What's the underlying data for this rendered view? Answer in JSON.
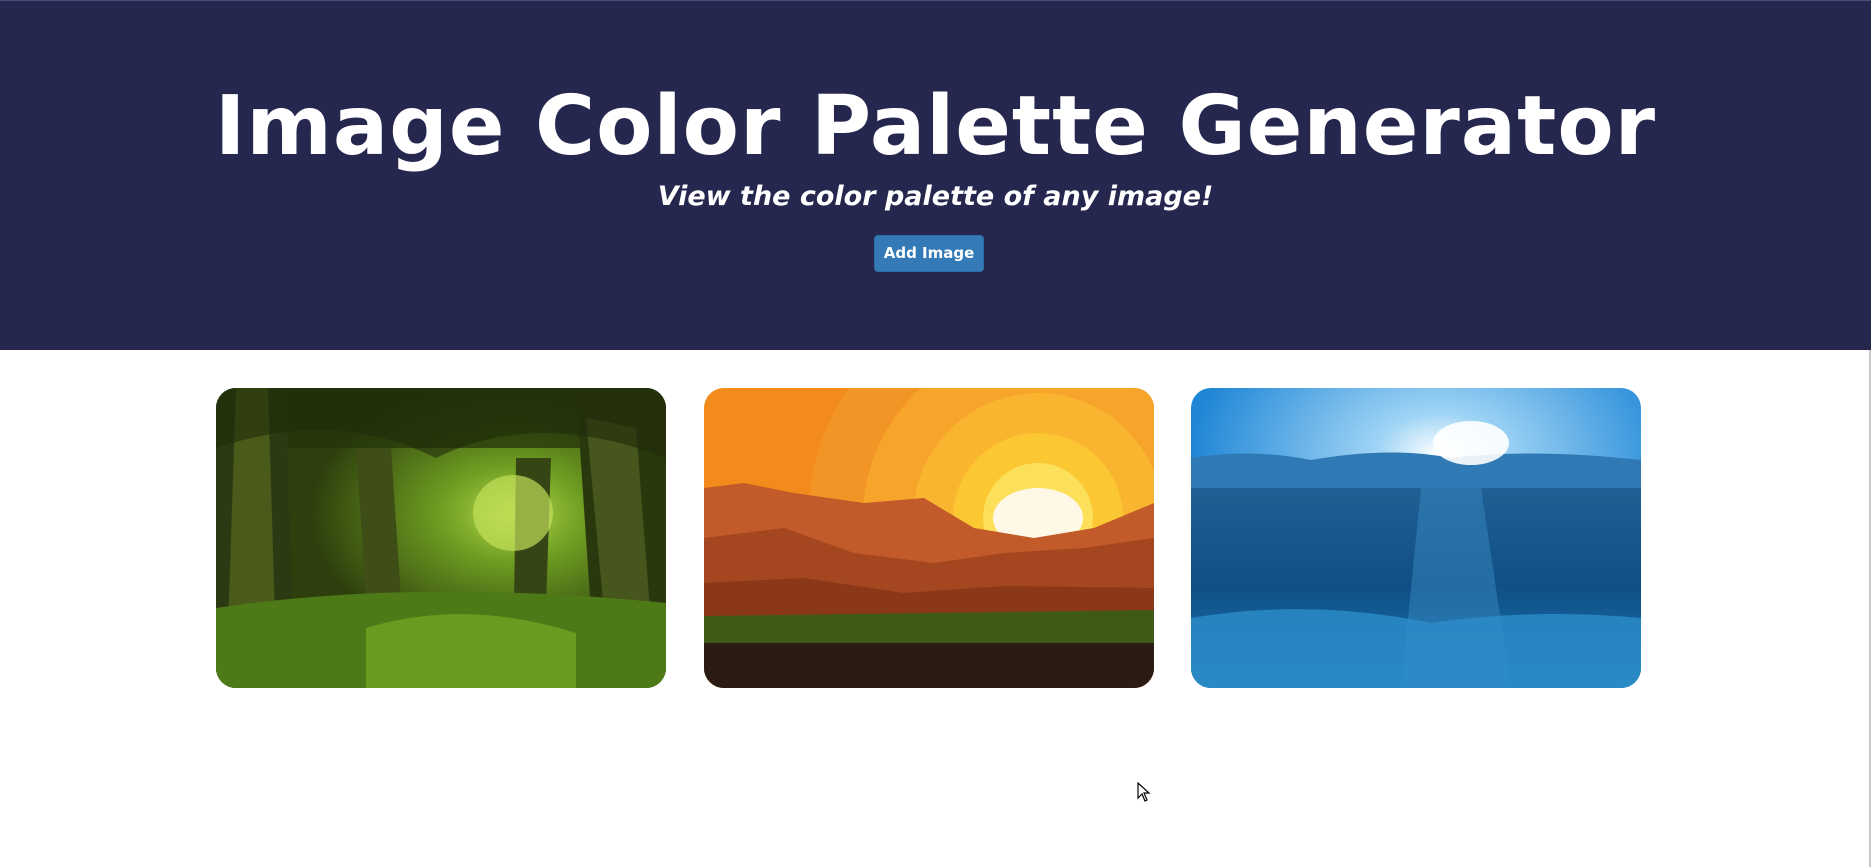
{
  "header": {
    "title": "Image Color Palette Generator",
    "subtitle": "View the color palette of any image!",
    "add_button_label": "Add Image"
  },
  "gallery": {
    "images": [
      {
        "subject": "forest-path"
      },
      {
        "subject": "desert-sunset"
      },
      {
        "subject": "underwater-ocean"
      }
    ]
  },
  "colors": {
    "header_background": "#26274f",
    "button_background": "#337ab7",
    "title_text": "#ffffff",
    "page_background": "#ffffff"
  }
}
